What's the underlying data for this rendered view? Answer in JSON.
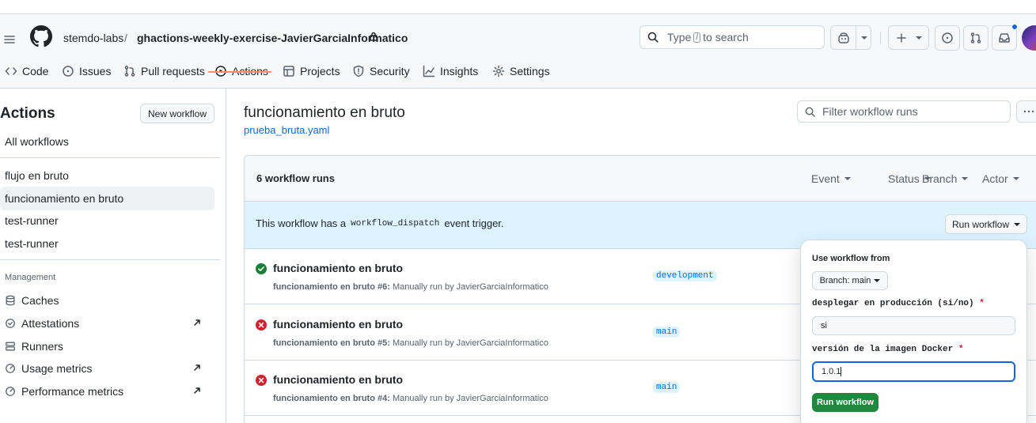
{
  "header": {
    "owner": "stemdo-labs",
    "separator": "/",
    "repo": "ghactions-weekly-exercise-JavierGarciaInformatico",
    "search_prefix": "Type",
    "search_key": "/",
    "search_suffix": "to search"
  },
  "nav": {
    "tabs": [
      {
        "label": "Code",
        "icon": "code-icon"
      },
      {
        "label": "Issues",
        "icon": "issue-icon"
      },
      {
        "label": "Pull requests",
        "icon": "pull-request-icon"
      },
      {
        "label": "Actions",
        "icon": "play-icon"
      },
      {
        "label": "Projects",
        "icon": "table-icon"
      },
      {
        "label": "Security",
        "icon": "shield-icon"
      },
      {
        "label": "Insights",
        "icon": "graph-icon"
      },
      {
        "label": "Settings",
        "icon": "gear-icon"
      }
    ],
    "active": "Actions"
  },
  "sidebar": {
    "title": "Actions",
    "new_workflow": "New workflow",
    "all_workflows": "All workflows",
    "workflows": [
      "flujo en bruto",
      "funcionamiento en bruto",
      "test-runner",
      "test-runner"
    ],
    "active_workflow": "funcionamiento en bruto",
    "management_title": "Management",
    "management": [
      {
        "label": "Caches",
        "icon": "database-icon",
        "external": false
      },
      {
        "label": "Attestations",
        "icon": "check-circle-icon",
        "external": true
      },
      {
        "label": "Runners",
        "icon": "server-icon",
        "external": false
      },
      {
        "label": "Usage metrics",
        "icon": "meter-icon",
        "external": true
      },
      {
        "label": "Performance metrics",
        "icon": "meter-icon",
        "external": true
      }
    ]
  },
  "main": {
    "title": "funcionamiento en bruto",
    "file_link": "prueba_bruta.yaml",
    "filter_placeholder": "Filter workflow runs",
    "runs_count": "6 workflow runs",
    "filters": [
      "Event",
      "Status",
      "Branch",
      "Actor"
    ],
    "dispatch_pre": "This workflow has a",
    "dispatch_code": "workflow_dispatch",
    "dispatch_post": "event trigger.",
    "run_workflow_button": "Run workflow",
    "runs": [
      {
        "title": "funcionamiento en bruto",
        "number": "funcionamiento en bruto #6:",
        "detail": "Manually run by JavierGarciaInformatico",
        "branch": "development",
        "status": "success"
      },
      {
        "title": "funcionamiento en bruto",
        "number": "funcionamiento en bruto #5:",
        "detail": "Manually run by JavierGarciaInformatico",
        "branch": "main",
        "status": "failure"
      },
      {
        "title": "funcionamiento en bruto",
        "number": "funcionamiento en bruto #4:",
        "detail": "Manually run by JavierGarciaInformatico",
        "branch": "main",
        "status": "failure"
      }
    ]
  },
  "popup": {
    "use_from": "Use workflow from",
    "branch_label": "Branch: main",
    "input1_label": "desplegar en producción (si/no)",
    "input1_value": "si",
    "input2_label": "versión de la imagen Docker",
    "input2_value": "1.0.1",
    "required_mark": "*",
    "submit": "Run workflow"
  },
  "colors": {
    "success": "#1a7f37",
    "failure": "#cf222e",
    "link": "#0969da",
    "primary_button": "#1f883d",
    "tab_underline": "#fd8c73"
  }
}
